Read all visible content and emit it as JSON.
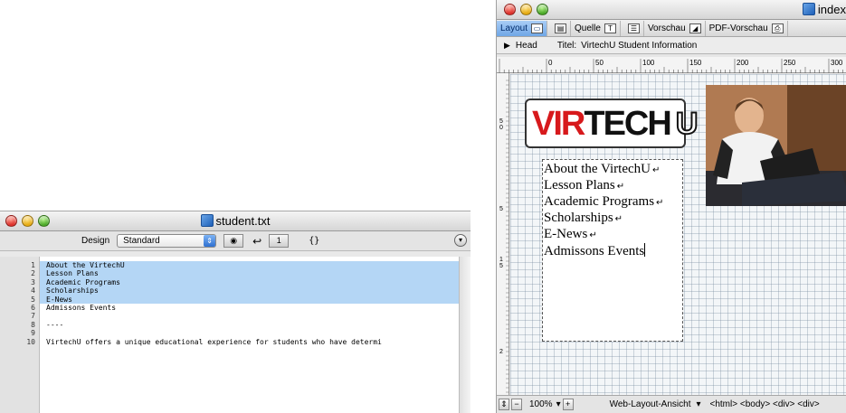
{
  "left_window": {
    "title": "student.txt",
    "toolbar": {
      "design_label": "Design",
      "design_value": "Standard",
      "line_indicator": "1",
      "braces": "{}"
    },
    "lines": [
      {
        "num": "1",
        "text": "About the VirtechU"
      },
      {
        "num": "2",
        "text": "Lesson Plans"
      },
      {
        "num": "3",
        "text": "Academic Programs"
      },
      {
        "num": "4",
        "text": "Scholarships"
      },
      {
        "num": "5",
        "text": "E-News"
      },
      {
        "num": "6",
        "text": "Admissons Events"
      },
      {
        "num": "7",
        "text": ""
      },
      {
        "num": "8",
        "text": "----"
      },
      {
        "num": "9",
        "text": ""
      },
      {
        "num": "10",
        "text": "VirtechU offers a unique educational experience for students who have determi"
      }
    ],
    "selected_lines": 6
  },
  "right_window": {
    "title": "index",
    "tabs": [
      {
        "label": "Layout",
        "active": true
      },
      {
        "label": "",
        "active": false
      },
      {
        "label": "Quelle",
        "active": false
      },
      {
        "label": "",
        "active": false
      },
      {
        "label": "Vorschau",
        "active": false
      },
      {
        "label": "PDF-Vorschau",
        "active": false
      }
    ],
    "head_label": "Head",
    "titel_label": "Titel:",
    "titel_value": "VirtechU Student Information",
    "ruler_ticks": [
      "0",
      "50",
      "100",
      "150",
      "200",
      "250",
      "300"
    ],
    "ruler_side_ticks": [
      "5",
      "0",
      "5",
      "1",
      "5",
      "2"
    ],
    "logo": {
      "part1": "VIR",
      "part2": "TECH",
      "part3": "U"
    },
    "text_box_lines": [
      "About the VirtechU",
      "Lesson Plans",
      "Academic Programs",
      "Scholarships",
      "E-News",
      "Admissons Events"
    ],
    "status": {
      "zoom": "100%",
      "mode": "Web-Layout-Ansicht",
      "tags": "<html> <body> <div> <div>"
    }
  },
  "colors": {
    "selection": "#b4d6f5",
    "logo_red": "#d7191c",
    "active_tab": "#6fa6e6"
  }
}
